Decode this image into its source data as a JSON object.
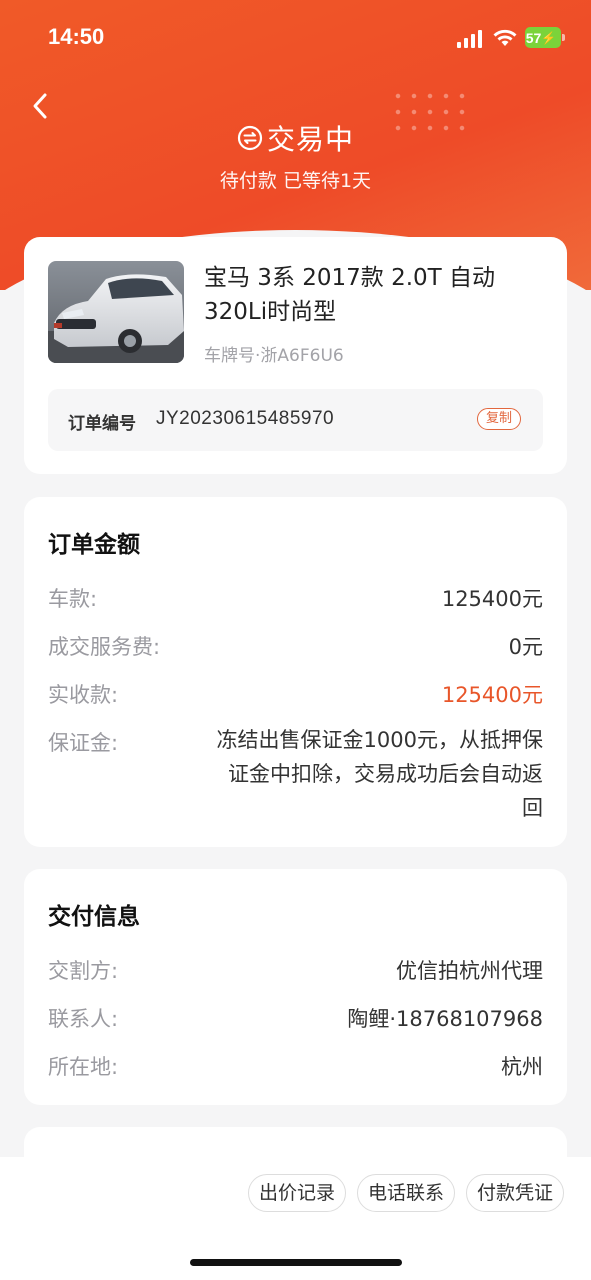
{
  "status_bar": {
    "time": "14:50",
    "battery": "57"
  },
  "header": {
    "title": "交易中",
    "subtitle": "待付款 已等待1天"
  },
  "car": {
    "title": "宝马 3系 2017款 2.0T 自动 320Li时尚型",
    "plate": "车牌号·浙A6F6U6",
    "order_label": "订单编号",
    "order_no": "JY20230615485970",
    "copy_label": "复制"
  },
  "amount": {
    "title": "订单金额",
    "rows": [
      {
        "label": "车款:",
        "value": "125400元"
      },
      {
        "label": "成交服务费:",
        "value": "0元"
      },
      {
        "label": "实收款:",
        "value": "125400元"
      },
      {
        "label": "保证金:",
        "value": "冻结出售保证金1000元，从抵押保证金中扣除，交易成功后会自动返回"
      }
    ],
    "highlight_color": "#e8562a"
  },
  "delivery": {
    "title": "交付信息",
    "rows": [
      {
        "label": "交割方:",
        "value": "优信拍杭州代理"
      },
      {
        "label": "联系人:",
        "value": "陶鲤·18768107968"
      },
      {
        "label": "所在地:",
        "value": "杭州"
      }
    ]
  },
  "actions": {
    "bid_history": "出价记录",
    "call": "电话联系",
    "payment_proof": "付款凭证"
  },
  "colors": {
    "brand": "#ee4f28",
    "accent": "#e2673e"
  }
}
